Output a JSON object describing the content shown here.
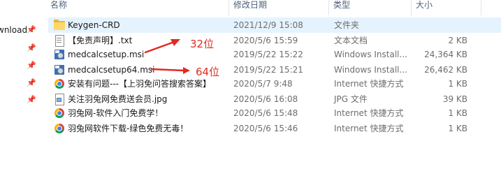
{
  "nav": {
    "items": [
      {
        "label": "wnload",
        "pinned": true
      },
      {
        "label": "",
        "pinned": true
      },
      {
        "label": "",
        "pinned": true
      },
      {
        "label": "",
        "pinned": true
      },
      {
        "label": "",
        "pinned": true
      }
    ]
  },
  "columns": {
    "name": "名称",
    "date": "修改日期",
    "type": "类型",
    "size": "大小"
  },
  "files": [
    {
      "name": "Keygen-CRD",
      "date": "2021/12/9 15:08",
      "type": "文件夹",
      "size": "",
      "icon": "folder-icon",
      "selected": true
    },
    {
      "name": "【免责声明】.txt",
      "date": "2020/5/6 15:59",
      "type": "文本文档",
      "size": "2 KB",
      "icon": "text-file-icon"
    },
    {
      "name": "medcalcsetup.msi",
      "date": "2019/5/22 15:22",
      "type": "Windows Install...",
      "size": "24,364 KB",
      "icon": "installer-icon"
    },
    {
      "name": "medcalcsetup64.msi",
      "date": "2019/5/22 15:21",
      "type": "Windows Install...",
      "size": "26,462 KB",
      "icon": "installer-icon"
    },
    {
      "name": "安装有问题---【上羽免问答搜索答案】",
      "date": "2020/5/7 9:48",
      "type": "Internet 快捷方式",
      "size": "1 KB",
      "icon": "internet-shortcut-icon"
    },
    {
      "name": "关注羽兔网免费送会员.jpg",
      "date": "2020/5/6 16:08",
      "type": "JPG 文件",
      "size": "39 KB",
      "icon": "jpg-file-icon"
    },
    {
      "name": "羽兔网-软件入门免费学！",
      "date": "2020/5/6 15:48",
      "type": "Internet 快捷方式",
      "size": "1 KB",
      "icon": "internet-shortcut-icon"
    },
    {
      "name": "羽兔网软件下载-绿色免费无毒！",
      "date": "2020/5/6 15:46",
      "type": "Internet 快捷方式",
      "size": "1 KB",
      "icon": "internet-shortcut-icon"
    }
  ],
  "annotations": {
    "label_32": "32位",
    "label_64": "64位",
    "color": "#e02b1f"
  }
}
